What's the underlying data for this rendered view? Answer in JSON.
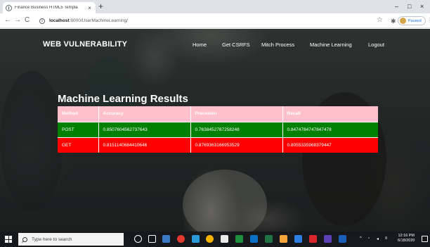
{
  "browser": {
    "tab_title": "Finance Business HTML5 Templa",
    "tab_close": "×",
    "new_tab": "+",
    "url_host": "localhost",
    "url_rest": ":8000/UserMachineLearning/",
    "profile_label": "Paused",
    "controls": {
      "minimize": "–",
      "maximize": "□",
      "close": "×"
    },
    "nav": {
      "back": "←",
      "forward": "→",
      "reload": "C"
    }
  },
  "site": {
    "brand": "WEB VULNERABILITY",
    "nav": {
      "home": "Home",
      "get_csrfs": "Get CSRFS",
      "mitch_process": "Mitch Process",
      "machine_learning": "Machine Learning",
      "logout": "Logout"
    }
  },
  "results": {
    "heading": "Machine Learning Results",
    "columns": [
      "Method",
      "Accuracy",
      "Precesion",
      "Recall"
    ],
    "rows": [
      {
        "method": "POST",
        "accuracy": "0.8507604562737643",
        "precesion": "0.7638452787258248",
        "recall": "0.8474784747847478"
      },
      {
        "method": "GET",
        "accuracy": "0.8151140684410646",
        "precesion": "0.8769363166953529",
        "recall": "0.8055335968379447"
      }
    ],
    "colors": {
      "header": "#ffc0cb",
      "post_row": "#008000",
      "get_row": "#ff0000"
    }
  },
  "taskbar": {
    "search_placeholder": "Type here to search",
    "time": "12:16 PM",
    "date": "6/18/2020"
  }
}
